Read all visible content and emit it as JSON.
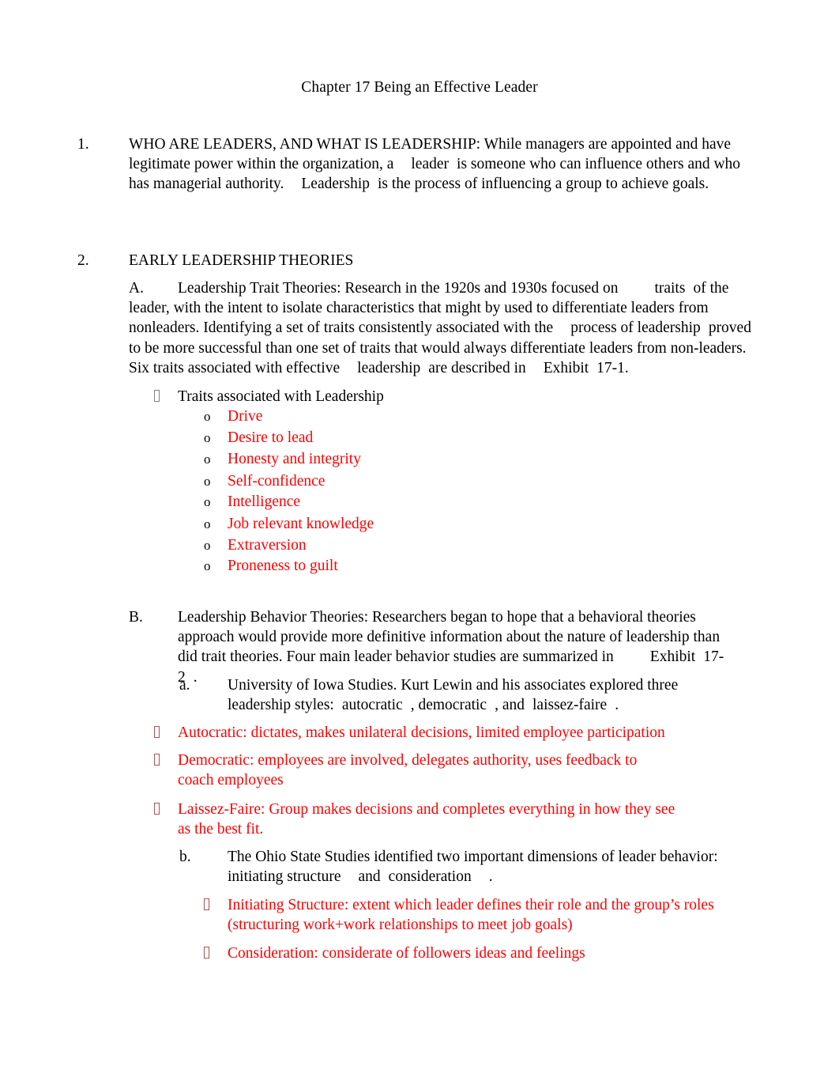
{
  "document": {
    "title": "Chapter 17 Being an Effective Leader",
    "accent_red": "#ff0000",
    "text_color": "#000000",
    "background": "#ffffff"
  },
  "sections": {
    "item1": {
      "marker": "1.",
      "text_part1": "WHO ARE LEADERS, AND WHAT IS LEADERSHIP: While managers are appointed and have legitimate power within the organization, a",
      "term1": "leader",
      "text_part2": "is someone who can influence others and who has managerial authority.",
      "term2": "Leadership",
      "text_part3": "is the process of influencing a group to achieve goals."
    },
    "item2": {
      "marker": "2.",
      "heading": "EARLY LEADERSHIP THEORIES"
    },
    "itemA": {
      "marker": "A.",
      "text_part1": "Leadership Trait Theories: Research in the 1920s and 1930s focused on",
      "term1": "traits",
      "text_part2": "of the leader, with the intent to isolate characteristics that might by used to differentiate leaders from nonleaders. Identifying a set of traits consistently associated with the",
      "term2": "process of leadership",
      "text_part3": "proved to be more successful than one set of traits that would always differentiate leaders from non-leaders. Six traits associated with effective",
      "term3": "leadership",
      "text_part4": "are described in",
      "term4": "Exhibit",
      "text_part5": "17-1."
    },
    "traits_bullet": {
      "label": "Traits associated with Leadership",
      "marker_glyph": "missing-glyph-box"
    },
    "traits_list": {
      "marker": "o",
      "items": [
        "Drive",
        "Desire to lead",
        "Honesty and integrity",
        "Self-confidence",
        "Intelligence",
        "Job relevant knowledge",
        "Extraversion",
        "Proneness to guilt"
      ]
    },
    "itemB": {
      "marker": "B.",
      "text_part1": "Leadership Behavior Theories: Researchers began to hope that a behavioral theories approach would provide more definitive information about the nature of leadership than did trait theories. Four main leader behavior studies are summarized in",
      "term1": "Exhibit",
      "text_part2": "17-2",
      "text_part3": "."
    },
    "item_a": {
      "marker": "a.",
      "text_part1": "University of Iowa Studies. Kurt Lewin and his associates explored three leadership styles:",
      "term1": "autocratic",
      "text_part2": ", democratic",
      "text_part3": ", and",
      "term2": "laissez-faire",
      "text_part4": "."
    },
    "styles_bullets": [
      "Autocratic: dictates, makes unilateral decisions, limited employee participation",
      "Democratic: employees are involved, delegates authority, uses feedback to coach employees",
      "Laissez-Faire: Group makes decisions and completes everything in how they see as the best fit."
    ],
    "item_b": {
      "marker": "b.",
      "text_part1": "The Ohio State Studies identified two important dimensions of leader behavior:",
      "term1": "initiating structure",
      "text_part2": "and",
      "term2": "consideration",
      "text_part3": "."
    },
    "ohio_bullets": [
      "Initiating Structure: extent which leader defines their role and the group’s roles (structuring work+work relationships to meet job goals)",
      "Consideration: considerate of followers ideas and feelings"
    ]
  }
}
